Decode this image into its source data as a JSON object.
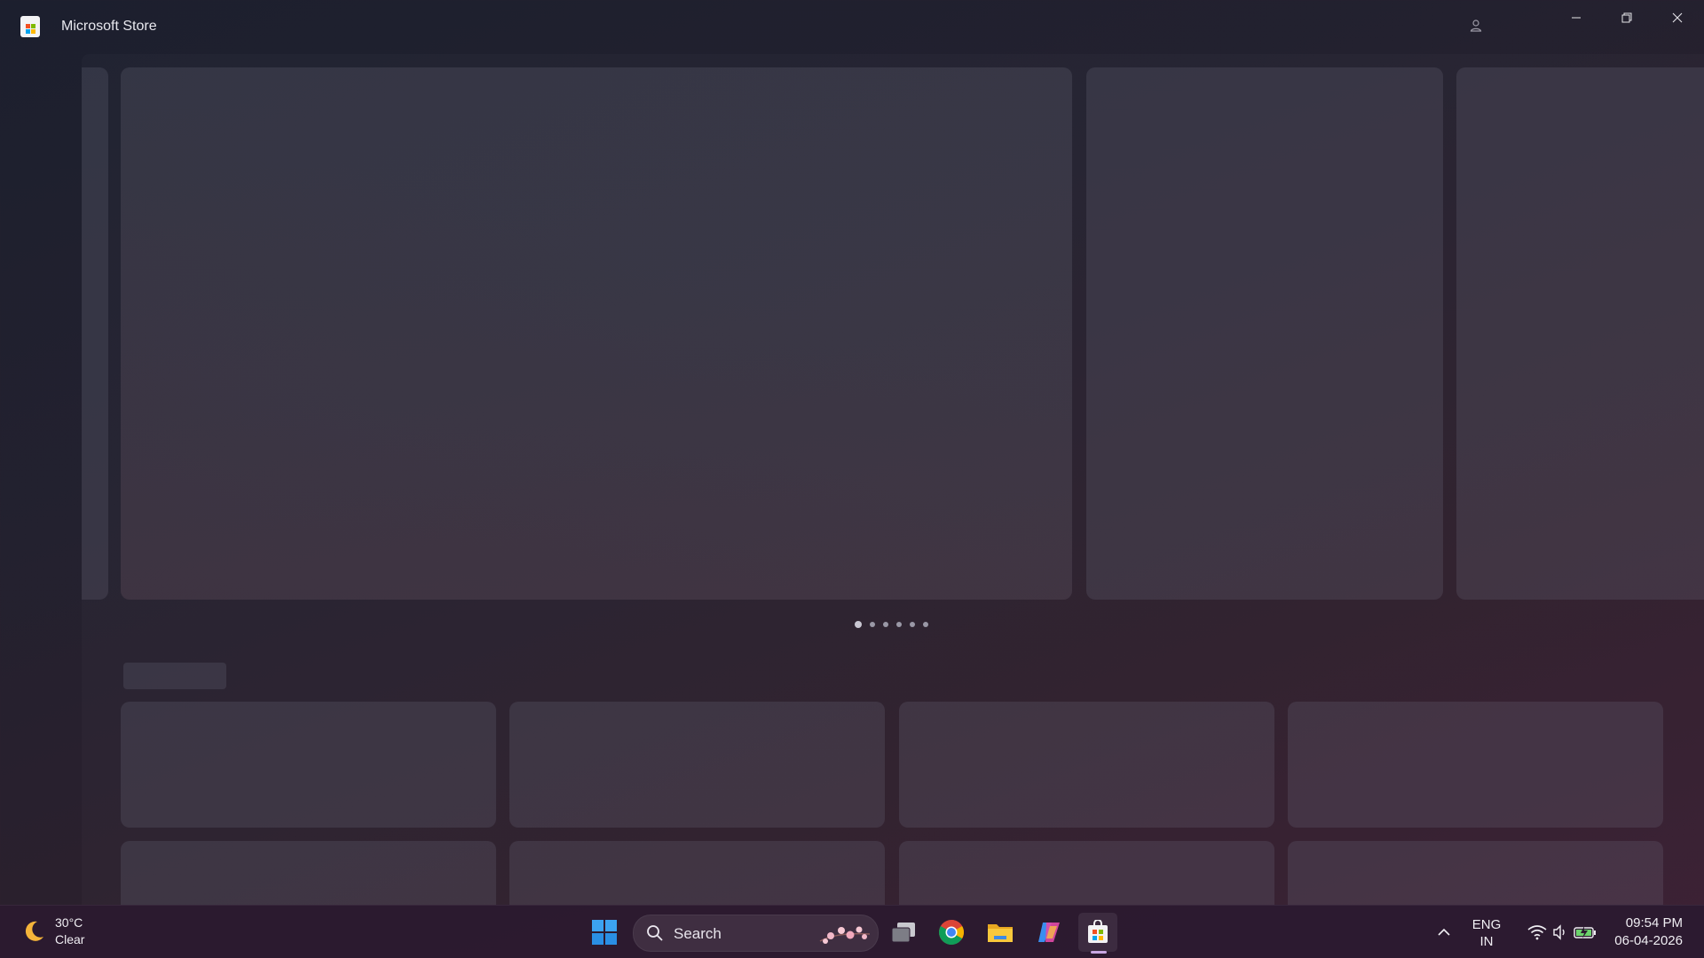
{
  "window": {
    "title": "Microsoft Store"
  },
  "carousel": {
    "page_count": 6,
    "active_index": 0
  },
  "taskbar": {
    "weather": {
      "temperature": "30°C",
      "condition": "Clear",
      "icon": "moon-icon"
    },
    "search": {
      "label": "Search"
    },
    "pinned": [
      {
        "name": "task-view",
        "icon": "task-view-icon"
      },
      {
        "name": "chrome",
        "icon": "chrome-icon"
      },
      {
        "name": "file-explorer",
        "icon": "folder-icon"
      },
      {
        "name": "copilot",
        "icon": "copilot-icon"
      },
      {
        "name": "microsoft-store",
        "icon": "store-icon",
        "active": true
      }
    ],
    "tray": {
      "language_line1": "ENG",
      "language_line2": "IN"
    },
    "clock": {
      "time": "09:54 PM",
      "date": "06-04-2026"
    }
  }
}
